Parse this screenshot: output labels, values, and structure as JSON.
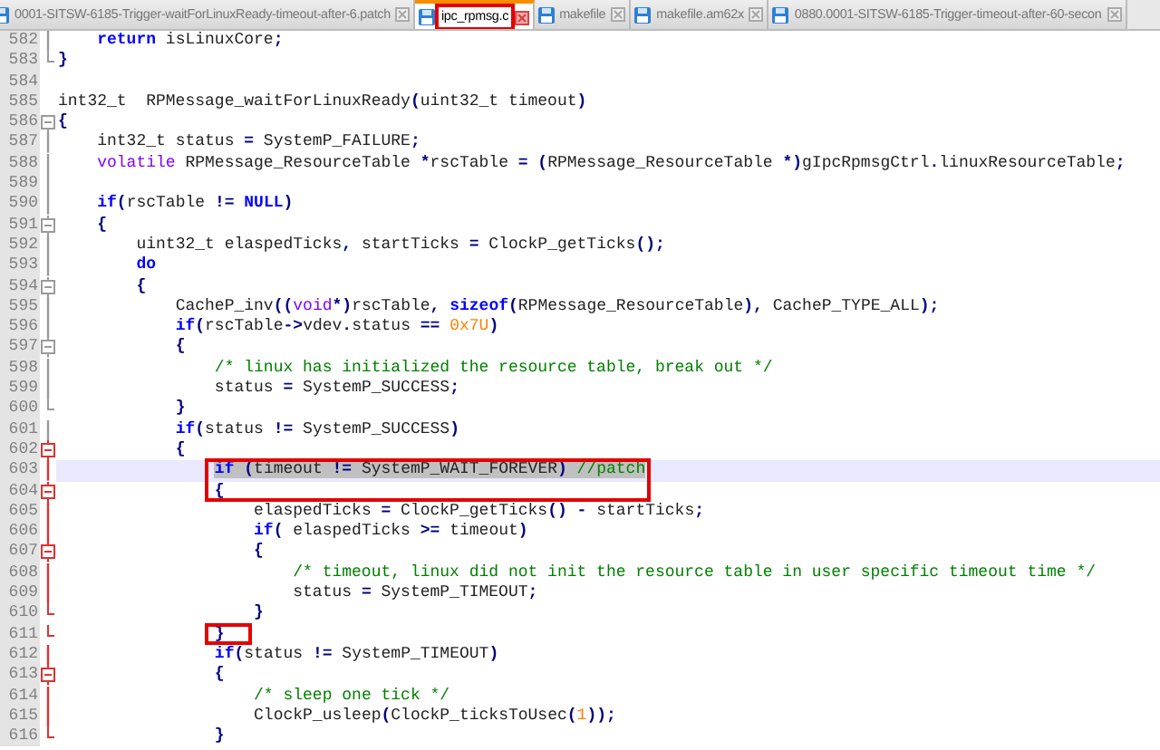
{
  "tabs": [
    {
      "label": "0001-SITSW-6185-Trigger-waitForLinuxReady-timeout-after-6.patch",
      "selected": false,
      "boxed": false
    },
    {
      "label": "ipc_rpmsg.c",
      "selected": true,
      "boxed": true
    },
    {
      "label": "makefile",
      "selected": false,
      "boxed": false
    },
    {
      "label": "makefile.am62x",
      "selected": false,
      "boxed": false
    },
    {
      "label": "0880.0001-SITSW-6185-Trigger-timeout-after-60-secon",
      "selected": false,
      "boxed": false
    }
  ],
  "lines": [
    {
      "number": "582",
      "fold_start": false,
      "fold_end": false,
      "current": false,
      "selected": false,
      "boxed": false,
      "tokens": [
        {
          "kind": "keyword",
          "text": "    return"
        },
        {
          "kind": "plain",
          "text": " isLinuxCore"
        },
        {
          "kind": "op",
          "text": ";"
        }
      ]
    },
    {
      "number": "583",
      "fold_start": false,
      "fold_end": true,
      "current": false,
      "selected": false,
      "boxed": false,
      "tokens": [
        {
          "kind": "op",
          "text": "}"
        }
      ]
    },
    {
      "number": "584",
      "fold_start": false,
      "fold_end": false,
      "current": false,
      "selected": false,
      "boxed": false
    },
    {
      "number": "585",
      "fold_start": false,
      "fold_end": false,
      "current": false,
      "selected": false,
      "boxed": false,
      "tokens": [
        {
          "kind": "plain",
          "text": "int32_t  RPMessage_waitForLinuxReady"
        },
        {
          "kind": "op",
          "text": "("
        },
        {
          "kind": "plain",
          "text": "uint32_t timeout"
        },
        {
          "kind": "op",
          "text": ")"
        }
      ]
    },
    {
      "number": "586",
      "fold_start": true,
      "fold_end": false,
      "current": false,
      "selected": false,
      "boxed": false,
      "tokens": [
        {
          "kind": "op",
          "text": "{"
        }
      ]
    },
    {
      "number": "587",
      "fold_start": false,
      "fold_end": false,
      "current": false,
      "selected": false,
      "boxed": false,
      "tokens": [
        {
          "kind": "plain",
          "text": "    int32_t status "
        },
        {
          "kind": "op",
          "text": "="
        },
        {
          "kind": "plain",
          "text": " SystemP_FAILURE"
        },
        {
          "kind": "op",
          "text": ";"
        }
      ]
    },
    {
      "number": "588",
      "fold_start": false,
      "fold_end": false,
      "current": false,
      "selected": false,
      "boxed": false,
      "tokens": [
        {
          "kind": "type",
          "text": "    volatile"
        },
        {
          "kind": "plain",
          "text": " RPMessage_ResourceTable "
        },
        {
          "kind": "op",
          "text": "*"
        },
        {
          "kind": "plain",
          "text": "rscTable "
        },
        {
          "kind": "op",
          "text": "= ("
        },
        {
          "kind": "plain",
          "text": "RPMessage_ResourceTable "
        },
        {
          "kind": "op",
          "text": "*)"
        },
        {
          "kind": "plain",
          "text": "gIpcRpmsgCtrl"
        },
        {
          "kind": "op",
          "text": "."
        },
        {
          "kind": "plain",
          "text": "linuxResourceTable"
        },
        {
          "kind": "op",
          "text": ";"
        }
      ]
    },
    {
      "number": "589",
      "fold_start": false,
      "fold_end": false,
      "current": false,
      "selected": false,
      "boxed": false
    },
    {
      "number": "590",
      "fold_start": false,
      "fold_end": false,
      "current": false,
      "selected": false,
      "boxed": false,
      "tokens": [
        {
          "kind": "keyword",
          "text": "    if"
        },
        {
          "kind": "op",
          "text": "("
        },
        {
          "kind": "plain",
          "text": "rscTable "
        },
        {
          "kind": "op",
          "text": "!="
        },
        {
          "kind": "keyword",
          "text": " NULL"
        },
        {
          "kind": "op",
          "text": ")"
        }
      ]
    },
    {
      "number": "591",
      "fold_start": true,
      "fold_end": false,
      "current": false,
      "selected": false,
      "boxed": false,
      "tokens": [
        {
          "kind": "op",
          "text": "    {"
        }
      ]
    },
    {
      "number": "592",
      "fold_start": false,
      "fold_end": false,
      "current": false,
      "selected": false,
      "boxed": false,
      "tokens": [
        {
          "kind": "plain",
          "text": "        uint32_t elaspedTicks"
        },
        {
          "kind": "op",
          "text": ","
        },
        {
          "kind": "plain",
          "text": " startTicks "
        },
        {
          "kind": "op",
          "text": "="
        },
        {
          "kind": "plain",
          "text": " ClockP_getTicks"
        },
        {
          "kind": "op",
          "text": "();"
        }
      ]
    },
    {
      "number": "593",
      "fold_start": false,
      "fold_end": false,
      "current": false,
      "selected": false,
      "boxed": false,
      "tokens": [
        {
          "kind": "keyword",
          "text": "        do"
        }
      ]
    },
    {
      "number": "594",
      "fold_start": true,
      "fold_end": false,
      "current": false,
      "selected": false,
      "boxed": false,
      "tokens": [
        {
          "kind": "op",
          "text": "        {"
        }
      ]
    },
    {
      "number": "595",
      "fold_start": false,
      "fold_end": false,
      "current": false,
      "selected": false,
      "boxed": false,
      "tokens": [
        {
          "kind": "plain",
          "text": "            CacheP_inv"
        },
        {
          "kind": "op",
          "text": "(("
        },
        {
          "kind": "type",
          "text": "void"
        },
        {
          "kind": "op",
          "text": "*)"
        },
        {
          "kind": "plain",
          "text": "rscTable"
        },
        {
          "kind": "op",
          "text": ","
        },
        {
          "kind": "keyword",
          "text": " sizeof"
        },
        {
          "kind": "op",
          "text": "("
        },
        {
          "kind": "plain",
          "text": "RPMessage_ResourceTable"
        },
        {
          "kind": "op",
          "text": "),"
        },
        {
          "kind": "plain",
          "text": " CacheP_TYPE_ALL"
        },
        {
          "kind": "op",
          "text": ");"
        }
      ]
    },
    {
      "number": "596",
      "fold_start": false,
      "fold_end": false,
      "current": false,
      "selected": false,
      "boxed": false,
      "tokens": [
        {
          "kind": "keyword",
          "text": "            if"
        },
        {
          "kind": "op",
          "text": "("
        },
        {
          "kind": "plain",
          "text": "rscTable"
        },
        {
          "kind": "op",
          "text": "->"
        },
        {
          "kind": "plain",
          "text": "vdev"
        },
        {
          "kind": "op",
          "text": "."
        },
        {
          "kind": "plain",
          "text": "status "
        },
        {
          "kind": "op",
          "text": "=="
        },
        {
          "kind": "number",
          "text": " 0x7U"
        },
        {
          "kind": "op",
          "text": ")"
        }
      ]
    },
    {
      "number": "597",
      "fold_start": true,
      "fold_end": false,
      "current": false,
      "selected": false,
      "boxed": false,
      "tokens": [
        {
          "kind": "op",
          "text": "            {"
        }
      ]
    },
    {
      "number": "598",
      "fold_start": false,
      "fold_end": false,
      "current": false,
      "selected": false,
      "boxed": false,
      "tokens": [
        {
          "kind": "comment",
          "text": "                /* linux has initialized the resource table, break out */"
        }
      ]
    },
    {
      "number": "599",
      "fold_start": false,
      "fold_end": false,
      "current": false,
      "selected": false,
      "boxed": false,
      "tokens": [
        {
          "kind": "plain",
          "text": "                status "
        },
        {
          "kind": "op",
          "text": "="
        },
        {
          "kind": "plain",
          "text": " SystemP_SUCCESS"
        },
        {
          "kind": "op",
          "text": ";"
        }
      ]
    },
    {
      "number": "600",
      "fold_start": false,
      "fold_end": true,
      "current": false,
      "selected": false,
      "boxed": false,
      "tokens": [
        {
          "kind": "op",
          "text": "            }"
        }
      ]
    },
    {
      "number": "601",
      "fold_start": false,
      "fold_end": false,
      "current": false,
      "selected": false,
      "boxed": false,
      "tokens": [
        {
          "kind": "keyword",
          "text": "            if"
        },
        {
          "kind": "op",
          "text": "("
        },
        {
          "kind": "plain",
          "text": "status "
        },
        {
          "kind": "op",
          "text": "!="
        },
        {
          "kind": "plain",
          "text": " SystemP_SUCCESS"
        },
        {
          "kind": "op",
          "text": ")"
        }
      ]
    },
    {
      "number": "602",
      "fold_start": true,
      "fold_end": false,
      "current": false,
      "selected": false,
      "boxed": false,
      "tokens": [
        {
          "kind": "op",
          "text": "            {"
        }
      ]
    },
    {
      "number": "603",
      "fold_start": false,
      "fold_end": false,
      "current": true,
      "selected": true,
      "boxed": true,
      "tokens": [
        {
          "kind": "keyword",
          "text": "                if"
        },
        {
          "kind": "op",
          "text": " ("
        },
        {
          "kind": "plain",
          "text": "timeout "
        },
        {
          "kind": "op",
          "text": "!="
        },
        {
          "kind": "plain",
          "text": " SystemP_WAIT_FOREVER"
        },
        {
          "kind": "op",
          "text": ")"
        },
        {
          "kind": "comment",
          "text": " //patch"
        }
      ]
    },
    {
      "number": "604",
      "fold_start": true,
      "fold_end": false,
      "current": false,
      "selected": false,
      "boxed": true,
      "tokens": [
        {
          "kind": "op",
          "text": "                {"
        }
      ]
    },
    {
      "number": "605",
      "fold_start": false,
      "fold_end": false,
      "current": false,
      "selected": false,
      "boxed": false,
      "tokens": [
        {
          "kind": "plain",
          "text": "                    elaspedTicks "
        },
        {
          "kind": "op",
          "text": "="
        },
        {
          "kind": "plain",
          "text": " ClockP_getTicks"
        },
        {
          "kind": "op",
          "text": "() -"
        },
        {
          "kind": "plain",
          "text": " startTicks"
        },
        {
          "kind": "op",
          "text": ";"
        }
      ]
    },
    {
      "number": "606",
      "fold_start": false,
      "fold_end": false,
      "current": false,
      "selected": false,
      "boxed": false,
      "tokens": [
        {
          "kind": "keyword",
          "text": "                    if"
        },
        {
          "kind": "op",
          "text": "("
        },
        {
          "kind": "plain",
          "text": " elaspedTicks "
        },
        {
          "kind": "op",
          "text": ">="
        },
        {
          "kind": "plain",
          "text": " timeout"
        },
        {
          "kind": "op",
          "text": ")"
        }
      ]
    },
    {
      "number": "607",
      "fold_start": true,
      "fold_end": false,
      "current": false,
      "selected": false,
      "boxed": false,
      "tokens": [
        {
          "kind": "op",
          "text": "                    {"
        }
      ]
    },
    {
      "number": "608",
      "fold_start": false,
      "fold_end": false,
      "current": false,
      "selected": false,
      "boxed": false,
      "tokens": [
        {
          "kind": "comment",
          "text": "                        /* timeout, linux did not init the resource table in user specific timeout time */"
        }
      ]
    },
    {
      "number": "609",
      "fold_start": false,
      "fold_end": false,
      "current": false,
      "selected": false,
      "boxed": false,
      "tokens": [
        {
          "kind": "plain",
          "text": "                        status "
        },
        {
          "kind": "op",
          "text": "="
        },
        {
          "kind": "plain",
          "text": " SystemP_TIMEOUT"
        },
        {
          "kind": "op",
          "text": ";"
        }
      ]
    },
    {
      "number": "610",
      "fold_start": false,
      "fold_end": true,
      "current": false,
      "selected": false,
      "boxed": false,
      "tokens": [
        {
          "kind": "op",
          "text": "                    }"
        }
      ]
    },
    {
      "number": "611",
      "fold_start": false,
      "fold_end": true,
      "current": false,
      "selected": false,
      "boxed": true,
      "tokens": [
        {
          "kind": "op",
          "text": "                }"
        }
      ]
    },
    {
      "number": "612",
      "fold_start": false,
      "fold_end": false,
      "current": false,
      "selected": false,
      "boxed": false,
      "tokens": [
        {
          "kind": "keyword",
          "text": "                if"
        },
        {
          "kind": "op",
          "text": "("
        },
        {
          "kind": "plain",
          "text": "status "
        },
        {
          "kind": "op",
          "text": "!="
        },
        {
          "kind": "plain",
          "text": " SystemP_TIMEOUT"
        },
        {
          "kind": "op",
          "text": ")"
        }
      ]
    },
    {
      "number": "613",
      "fold_start": true,
      "fold_end": false,
      "current": false,
      "selected": false,
      "boxed": false,
      "tokens": [
        {
          "kind": "op",
          "text": "                {"
        }
      ]
    },
    {
      "number": "614",
      "fold_start": false,
      "fold_end": false,
      "current": false,
      "selected": false,
      "boxed": false,
      "tokens": [
        {
          "kind": "comment",
          "text": "                    /* sleep one tick */"
        }
      ]
    },
    {
      "number": "615",
      "fold_start": false,
      "fold_end": false,
      "current": false,
      "selected": false,
      "boxed": false,
      "tokens": [
        {
          "kind": "plain",
          "text": "                    ClockP_usleep"
        },
        {
          "kind": "op",
          "text": "("
        },
        {
          "kind": "plain",
          "text": "ClockP_ticksToUsec"
        },
        {
          "kind": "op",
          "text": "("
        },
        {
          "kind": "number",
          "text": "1"
        },
        {
          "kind": "op",
          "text": "));"
        }
      ]
    },
    {
      "number": "616",
      "fold_start": false,
      "fold_end": true,
      "current": false,
      "selected": false,
      "boxed": false,
      "tokens": [
        {
          "kind": "op",
          "text": "                }"
        }
      ]
    }
  ]
}
